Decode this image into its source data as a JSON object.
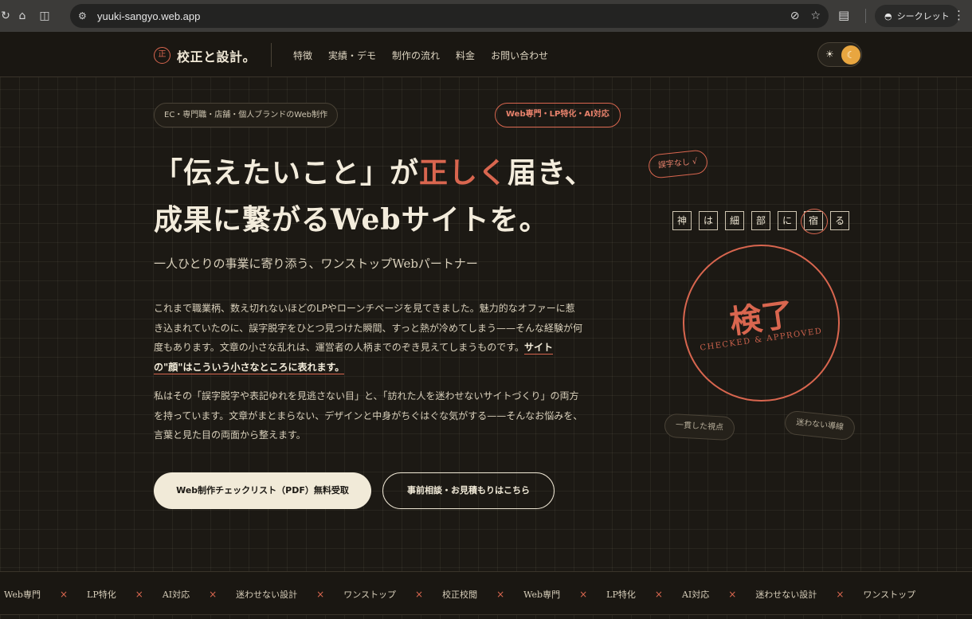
{
  "browser": {
    "url": "yuuki-sangyo.web.app",
    "incognito_label": "シークレット"
  },
  "header": {
    "logo_mark": "正",
    "logo_text": "校正と設計。",
    "nav": [
      "特徴",
      "実績・デモ",
      "制作の流れ",
      "料金",
      "お問い合わせ"
    ],
    "theme_sun": "☀",
    "theme_moon": "☾"
  },
  "hero": {
    "pill_left": "EC・専門職・店舗・個人ブランドのWeb制作",
    "pill_right": "Web専門・LP特化・AI対応",
    "headline_line1_pre": "「伝えたいこと」が",
    "headline_line1_accent": "正しく",
    "headline_line1_post": "届き、",
    "headline_line2": "成果に繋がるWebサイトを。",
    "subline": "一人ひとりの事業に寄り添う、ワンストップWebパートナー",
    "para1_text": "これまで職業柄、数え切れないほどのLPやローンチページを見てきました。魅力的なオファーに惹き込まれていたのに、誤字脱字をひとつ見つけた瞬間、すっと熱が冷めてしまう——そんな経験が何度もあります。文章の小さな乱れは、運営者の人柄までのぞき見えてしまうものです。",
    "para1_emphasis": "サイトの\"顔\"はこういう小さなところに表れます。",
    "para2": "私はその「誤字脱字や表記ゆれを見逃さない目」と、「訪れた人を迷わせないサイトづくり」の両方を持っています。文章がまとまらない、デザインと中身がちぐはぐな気がする——そんなお悩みを、言葉と見た目の両面から整えます。",
    "btn_primary": "Web制作チェックリスト（PDF）無料受取",
    "btn_secondary": "事前相談・お見積もりはこちら"
  },
  "illustration": {
    "typo_tag": "誤字なし √",
    "proverb_chars": [
      "神",
      "は",
      "細",
      "部",
      "に",
      "宿",
      "る"
    ],
    "marked_char": "宿",
    "stamp_main": "検了",
    "stamp_sub": "CHECKED & APPROVED",
    "tag_left": "一貫した視点",
    "tag_right": "迷わない導線"
  },
  "ticker": {
    "items": [
      "Web専門",
      "LP特化",
      "AI対応",
      "迷わせない設計",
      "ワンストップ",
      "校正校閲",
      "Web専門",
      "LP特化",
      "AI対応",
      "迷わせない設計",
      "ワンストップ"
    ],
    "separator": "×"
  },
  "colors": {
    "background": "#1c1914",
    "accent": "#d9664f",
    "cream": "#f1ead8",
    "toggle": "#e8a640"
  }
}
